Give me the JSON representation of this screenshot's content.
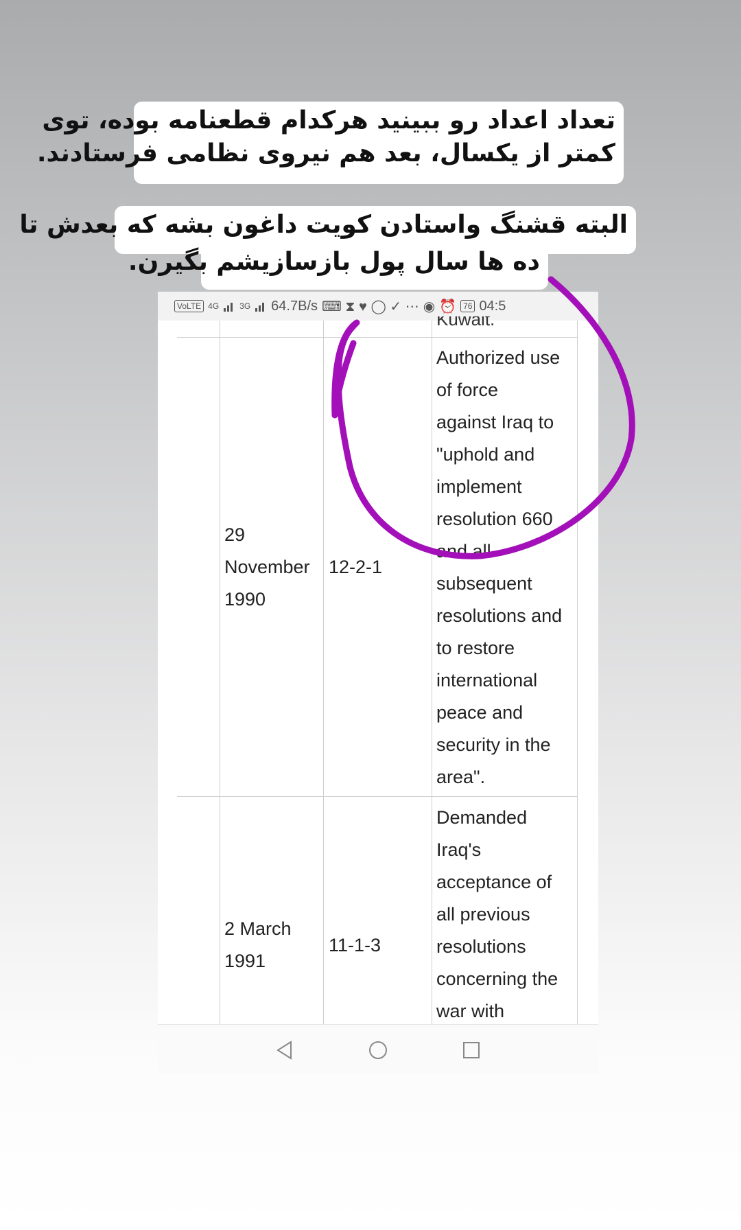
{
  "captions": {
    "line1": "تعداد اعداد رو ببینید هرکدام قطعنامه بوده، توی",
    "line2": "کمتر از یکسال، بعد هم نیروی نظامی فرستادند.",
    "line3": "البته قشنگ واستادن کویت داغون بشه که بعدش تا",
    "line4": "ده ها سال پول بازسازیشم بگیرن."
  },
  "statusbar": {
    "volte": "VoLTE",
    "net1": "4G",
    "net2": "3G",
    "speed": "64.7B/s",
    "battery": "76",
    "time": "04:5"
  },
  "table": {
    "cut_text": "Kuwait.",
    "rows": [
      {
        "date": [
          "29",
          "November",
          "1990"
        ],
        "vote": "12-2-1",
        "description": [
          "Authorized use",
          "of force",
          "against Iraq to",
          "\"uphold and",
          "implement",
          "resolution 660",
          "and all",
          "subsequent",
          "resolutions and",
          "to restore",
          "international",
          "peace and",
          "security in the",
          "area\"."
        ]
      },
      {
        "date": [
          "2 March",
          "1991"
        ],
        "vote": "11-1-3",
        "description": [
          "Demanded",
          "Iraq's",
          "acceptance of",
          "all previous",
          "resolutions",
          "concerning the",
          "war with"
        ]
      }
    ]
  },
  "annotation": {
    "color": "#a30fb8"
  }
}
